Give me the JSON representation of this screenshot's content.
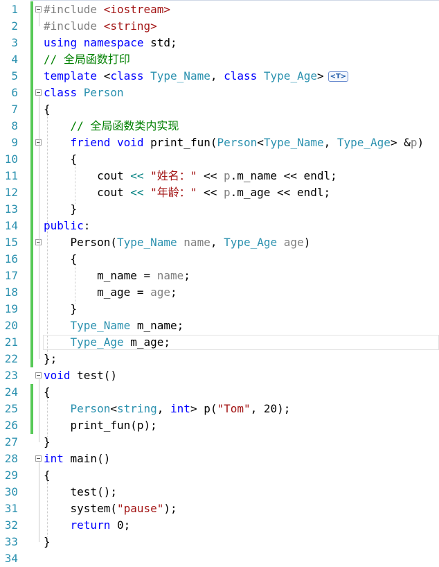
{
  "editor": {
    "lines": [
      {
        "n": "1",
        "fold": true,
        "chg": true,
        "tokens": [
          {
            "t": "#include ",
            "c": "pp"
          },
          {
            "t": "<iostream>",
            "c": "inc"
          }
        ]
      },
      {
        "n": "2",
        "fold": false,
        "chg": true,
        "tokens": [
          {
            "t": "#include ",
            "c": "pp"
          },
          {
            "t": "<string>",
            "c": "inc"
          }
        ]
      },
      {
        "n": "3",
        "fold": false,
        "chg": true,
        "tokens": [
          {
            "t": "using ",
            "c": "kw"
          },
          {
            "t": "namespace ",
            "c": "kw"
          },
          {
            "t": "std;",
            "c": ""
          }
        ]
      },
      {
        "n": "4",
        "fold": false,
        "chg": true,
        "tokens": [
          {
            "t": "// 全局函数打印",
            "c": "cm"
          }
        ]
      },
      {
        "n": "5",
        "fold": false,
        "chg": true,
        "badge": "<T>",
        "tokens": [
          {
            "t": "template ",
            "c": "kw"
          },
          {
            "t": "<",
            "c": ""
          },
          {
            "t": "class ",
            "c": "kw"
          },
          {
            "t": "Type_Name",
            "c": "ty"
          },
          {
            "t": ", ",
            "c": ""
          },
          {
            "t": "class ",
            "c": "kw"
          },
          {
            "t": "Type_Age",
            "c": "ty"
          },
          {
            "t": ">",
            "c": ""
          }
        ]
      },
      {
        "n": "6",
        "fold": true,
        "chg": true,
        "tokens": [
          {
            "t": "class ",
            "c": "kw"
          },
          {
            "t": "Person",
            "c": "ty"
          }
        ]
      },
      {
        "n": "7",
        "fold": false,
        "chg": true,
        "tokens": [
          {
            "t": "{",
            "c": ""
          }
        ]
      },
      {
        "n": "8",
        "fold": false,
        "chg": true,
        "tokens": [
          {
            "t": "    // 全局函数类内实现",
            "c": "cm"
          }
        ]
      },
      {
        "n": "9",
        "fold": true,
        "chg": true,
        "tokens": [
          {
            "t": "    ",
            "c": ""
          },
          {
            "t": "friend ",
            "c": "kw"
          },
          {
            "t": "void ",
            "c": "kw"
          },
          {
            "t": "print_fun(",
            "c": ""
          },
          {
            "t": "Person",
            "c": "ty"
          },
          {
            "t": "<",
            "c": ""
          },
          {
            "t": "Type_Name",
            "c": "ty"
          },
          {
            "t": ", ",
            "c": ""
          },
          {
            "t": "Type_Age",
            "c": "ty"
          },
          {
            "t": "> &",
            "c": ""
          },
          {
            "t": "p",
            "c": "par"
          },
          {
            "t": ")",
            "c": ""
          }
        ]
      },
      {
        "n": "10",
        "fold": false,
        "chg": true,
        "tokens": [
          {
            "t": "    {",
            "c": ""
          }
        ]
      },
      {
        "n": "11",
        "fold": false,
        "chg": true,
        "tokens": [
          {
            "t": "        cout ",
            "c": ""
          },
          {
            "t": "<<",
            "c": "op"
          },
          {
            "t": " ",
            "c": ""
          },
          {
            "t": "\"姓名：\"",
            "c": "str"
          },
          {
            "t": " << ",
            "c": ""
          },
          {
            "t": "p",
            "c": "par"
          },
          {
            "t": ".m_name << endl;",
            "c": ""
          }
        ]
      },
      {
        "n": "12",
        "fold": false,
        "chg": true,
        "tokens": [
          {
            "t": "        cout ",
            "c": ""
          },
          {
            "t": "<<",
            "c": "op"
          },
          {
            "t": " ",
            "c": ""
          },
          {
            "t": "\"年龄：\"",
            "c": "str"
          },
          {
            "t": " << ",
            "c": ""
          },
          {
            "t": "p",
            "c": "par"
          },
          {
            "t": ".m_age << endl;",
            "c": ""
          }
        ]
      },
      {
        "n": "13",
        "fold": false,
        "chg": true,
        "tokens": [
          {
            "t": "    }",
            "c": ""
          }
        ]
      },
      {
        "n": "14",
        "fold": false,
        "chg": true,
        "tokens": [
          {
            "t": "public",
            "c": "kw"
          },
          {
            "t": ":",
            "c": ""
          }
        ]
      },
      {
        "n": "15",
        "fold": true,
        "chg": true,
        "tokens": [
          {
            "t": "    Person(",
            "c": ""
          },
          {
            "t": "Type_Name ",
            "c": "ty"
          },
          {
            "t": "name",
            "c": "par"
          },
          {
            "t": ", ",
            "c": ""
          },
          {
            "t": "Type_Age ",
            "c": "ty"
          },
          {
            "t": "age",
            "c": "par"
          },
          {
            "t": ")",
            "c": ""
          }
        ]
      },
      {
        "n": "16",
        "fold": false,
        "chg": true,
        "tokens": [
          {
            "t": "    {",
            "c": ""
          }
        ]
      },
      {
        "n": "17",
        "fold": false,
        "chg": true,
        "tokens": [
          {
            "t": "        m_name = ",
            "c": ""
          },
          {
            "t": "name",
            "c": "par"
          },
          {
            "t": ";",
            "c": ""
          }
        ]
      },
      {
        "n": "18",
        "fold": false,
        "chg": true,
        "tokens": [
          {
            "t": "        m_age = ",
            "c": ""
          },
          {
            "t": "age",
            "c": "par"
          },
          {
            "t": ";",
            "c": ""
          }
        ]
      },
      {
        "n": "19",
        "fold": false,
        "chg": true,
        "tokens": [
          {
            "t": "    }",
            "c": ""
          }
        ]
      },
      {
        "n": "20",
        "fold": false,
        "chg": true,
        "tokens": [
          {
            "t": "    ",
            "c": ""
          },
          {
            "t": "Type_Name ",
            "c": "ty"
          },
          {
            "t": "m_name;",
            "c": ""
          }
        ]
      },
      {
        "n": "21",
        "fold": false,
        "chg": true,
        "cur": true,
        "tokens": [
          {
            "t": "    ",
            "c": ""
          },
          {
            "t": "Type_Age ",
            "c": "ty"
          },
          {
            "t": "m_age;",
            "c": ""
          }
        ]
      },
      {
        "n": "22",
        "fold": false,
        "chg": true,
        "tokens": [
          {
            "t": "};",
            "c": ""
          }
        ]
      },
      {
        "n": "23",
        "fold": true,
        "chg": false,
        "tokens": [
          {
            "t": "void ",
            "c": "kw"
          },
          {
            "t": "test()",
            "c": ""
          }
        ]
      },
      {
        "n": "24",
        "fold": false,
        "chg": true,
        "tokens": [
          {
            "t": "{",
            "c": ""
          }
        ]
      },
      {
        "n": "25",
        "fold": false,
        "chg": true,
        "tokens": [
          {
            "t": "    ",
            "c": ""
          },
          {
            "t": "Person",
            "c": "ty"
          },
          {
            "t": "<",
            "c": ""
          },
          {
            "t": "string",
            "c": "ty"
          },
          {
            "t": ", ",
            "c": ""
          },
          {
            "t": "int",
            "c": "kw"
          },
          {
            "t": "> p(",
            "c": ""
          },
          {
            "t": "\"Tom\"",
            "c": "str"
          },
          {
            "t": ", 20);",
            "c": ""
          }
        ]
      },
      {
        "n": "26",
        "fold": false,
        "chg": true,
        "tokens": [
          {
            "t": "    print_fun(p);",
            "c": ""
          }
        ]
      },
      {
        "n": "27",
        "fold": false,
        "chg": false,
        "tokens": [
          {
            "t": "}",
            "c": ""
          }
        ]
      },
      {
        "n": "28",
        "fold": true,
        "chg": false,
        "tokens": [
          {
            "t": "int ",
            "c": "kw"
          },
          {
            "t": "main()",
            "c": ""
          }
        ]
      },
      {
        "n": "29",
        "fold": false,
        "chg": false,
        "tokens": [
          {
            "t": "{",
            "c": ""
          }
        ]
      },
      {
        "n": "30",
        "fold": false,
        "chg": false,
        "tokens": [
          {
            "t": "    test();",
            "c": ""
          }
        ]
      },
      {
        "n": "31",
        "fold": false,
        "chg": false,
        "tokens": [
          {
            "t": "    system(",
            "c": ""
          },
          {
            "t": "\"pause\"",
            "c": "str"
          },
          {
            "t": ");",
            "c": ""
          }
        ]
      },
      {
        "n": "32",
        "fold": false,
        "chg": false,
        "tokens": [
          {
            "t": "    ",
            "c": ""
          },
          {
            "t": "return ",
            "c": "kw"
          },
          {
            "t": "0;",
            "c": ""
          }
        ]
      },
      {
        "n": "33",
        "fold": false,
        "chg": false,
        "tokens": [
          {
            "t": "}",
            "c": ""
          }
        ]
      },
      {
        "n": "34",
        "fold": false,
        "chg": false,
        "tokens": []
      }
    ]
  }
}
